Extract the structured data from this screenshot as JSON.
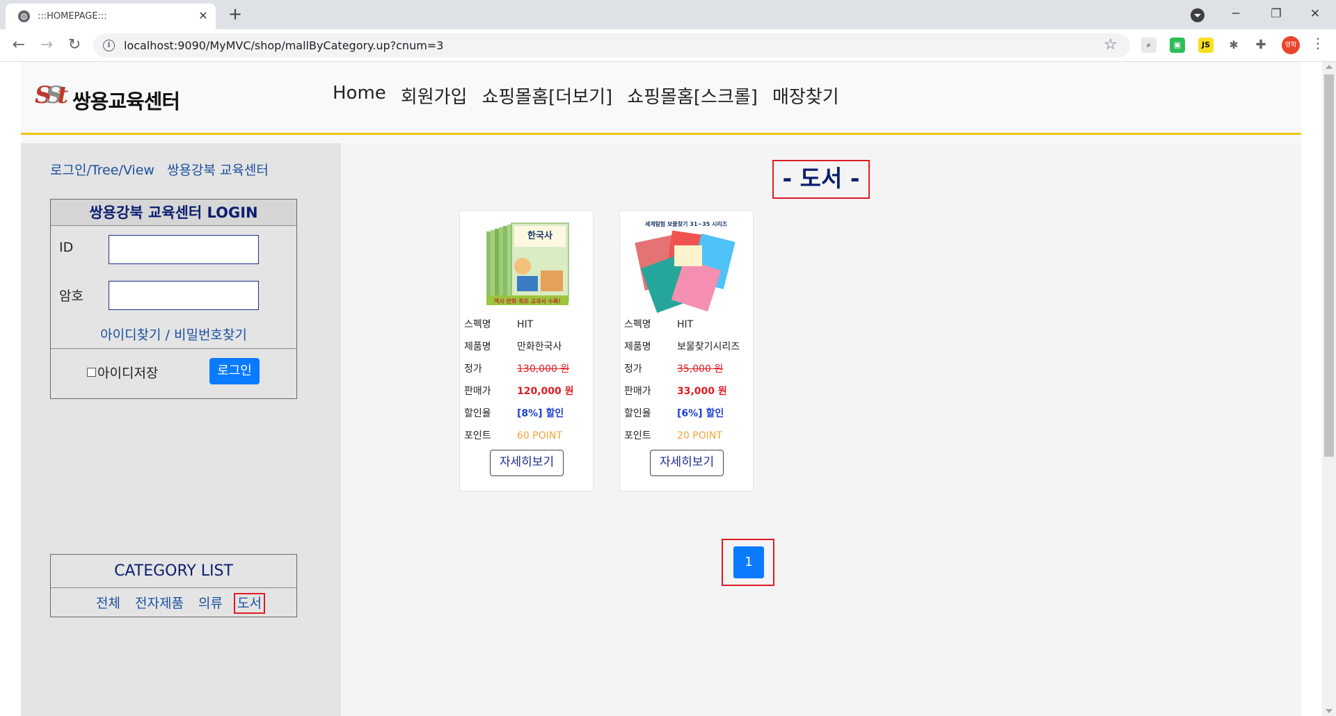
{
  "browser": {
    "tab_title": ":::HOMEPAGE:::",
    "url": "localhost:9090/MyMVC/shop/mallByCategory.up?cnum=3",
    "profile_label": "영학",
    "ext_js_label": "JS"
  },
  "header": {
    "logo_text": "쌍용교육센터",
    "logo_mark": "SSt",
    "nav": [
      "Home",
      "회원가입",
      "쇼핑몰홈[더보기]",
      "쇼핑몰홈[스크롤]",
      "매장찾기"
    ]
  },
  "sidebar": {
    "links": [
      "로그인/Tree/View",
      "쌍용강북 교육센터"
    ],
    "login": {
      "title": "쌍용강북 교육센터 LOGIN",
      "id_label": "ID",
      "pw_label": "암호",
      "find_link": "아이디찾기 / 비밀번호찾기",
      "save_id_label": "아이디저장",
      "login_button": "로그인"
    },
    "category": {
      "title": "CATEGORY LIST",
      "items": [
        "전체",
        "전자제품",
        "의류",
        "도서"
      ],
      "active": "도서"
    }
  },
  "content": {
    "heading": "- 도서 -",
    "labels": {
      "spec": "스펙명",
      "name": "제품명",
      "price": "정가",
      "sale": "판매가",
      "rate": "할인율",
      "point": "포인트"
    },
    "products": [
      {
        "spec": "HIT",
        "name": "만화한국사",
        "price": "130,000 원",
        "sale": "120,000 원",
        "rate": "[8%] 할인",
        "point": "60 POINT",
        "button": "자세히보기",
        "thumb_caption": "역사 만화 최초 교과서 수록!",
        "thumb_title": "한국사"
      },
      {
        "spec": "HIT",
        "name": "보물찾기시리즈",
        "price": "35,000 원",
        "sale": "33,000 원",
        "rate": "[6%] 할인",
        "point": "20 POINT",
        "button": "자세히보기",
        "thumb_caption": "세계탐험 보물찾기 31~35 시리즈",
        "thumb_title": ""
      }
    ],
    "pagination": [
      "1"
    ]
  },
  "colors": {
    "accent": "#0a7bff",
    "highlight": "#e01b24",
    "header_rule": "#f0c419",
    "heading": "#0b1f6e"
  }
}
